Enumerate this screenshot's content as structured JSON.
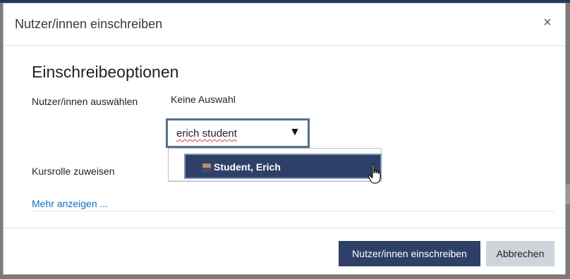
{
  "dialog": {
    "title": "Nutzer/innen einschreiben",
    "close_symbol": "×"
  },
  "section": {
    "heading": "Einschreibeoptionen"
  },
  "form": {
    "select_users_label": "Nutzer/innen auswählen",
    "no_selection_text": "Keine Auswahl",
    "search_value": "erich student",
    "dropdown_arrow": "▼",
    "suggestions": [
      {
        "name": "Student, Erich",
        "icon": "user-avatar-icon"
      }
    ],
    "course_role_label": "Kursrolle zuweisen",
    "show_more_link": "Mehr anzeigen ..."
  },
  "footer": {
    "enrol_button": "Nutzer/innen einschreiben",
    "cancel_button": "Abbrechen"
  },
  "colors": {
    "primary": "#2f4068",
    "secondary": "#ced4da",
    "link": "#0f6cbf",
    "focus_border": "#5a6e8c"
  }
}
